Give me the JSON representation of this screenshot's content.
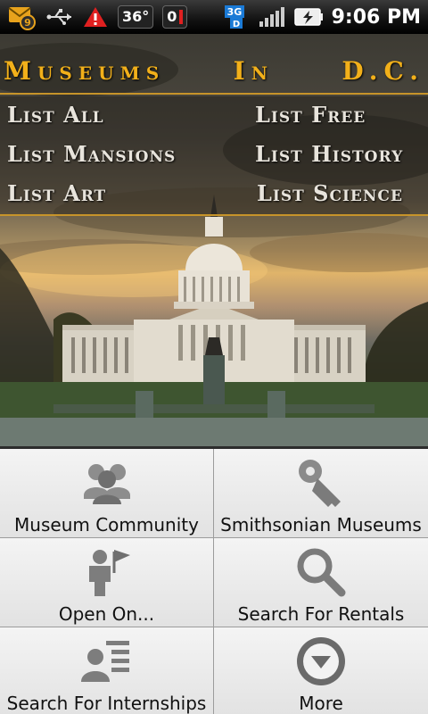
{
  "status_bar": {
    "notification_count": "9",
    "temperature": "36°",
    "counter": "0",
    "network": "3G",
    "time": "9:06 PM"
  },
  "header": {
    "title_words": [
      "Museums",
      "In",
      "D.C."
    ]
  },
  "list_links": [
    {
      "label": "List All"
    },
    {
      "label": "List Free"
    },
    {
      "label": "List Mansions"
    },
    {
      "label": "List History"
    },
    {
      "label": "List Art"
    },
    {
      "label": "List Science"
    }
  ],
  "grid": [
    {
      "label": "Museum Community",
      "icon": "people-icon"
    },
    {
      "label": "Smithsonian Museums",
      "icon": "key-icon"
    },
    {
      "label": "Open On...",
      "icon": "person-flag-icon"
    },
    {
      "label": "Search For Rentals",
      "icon": "magnifier-icon"
    },
    {
      "label": "Search For Internships",
      "icon": "person-list-icon"
    },
    {
      "label": "More",
      "icon": "chevron-down-circle-icon"
    }
  ],
  "colors": {
    "title": "#f2b01a",
    "rule": "#c7942a"
  }
}
